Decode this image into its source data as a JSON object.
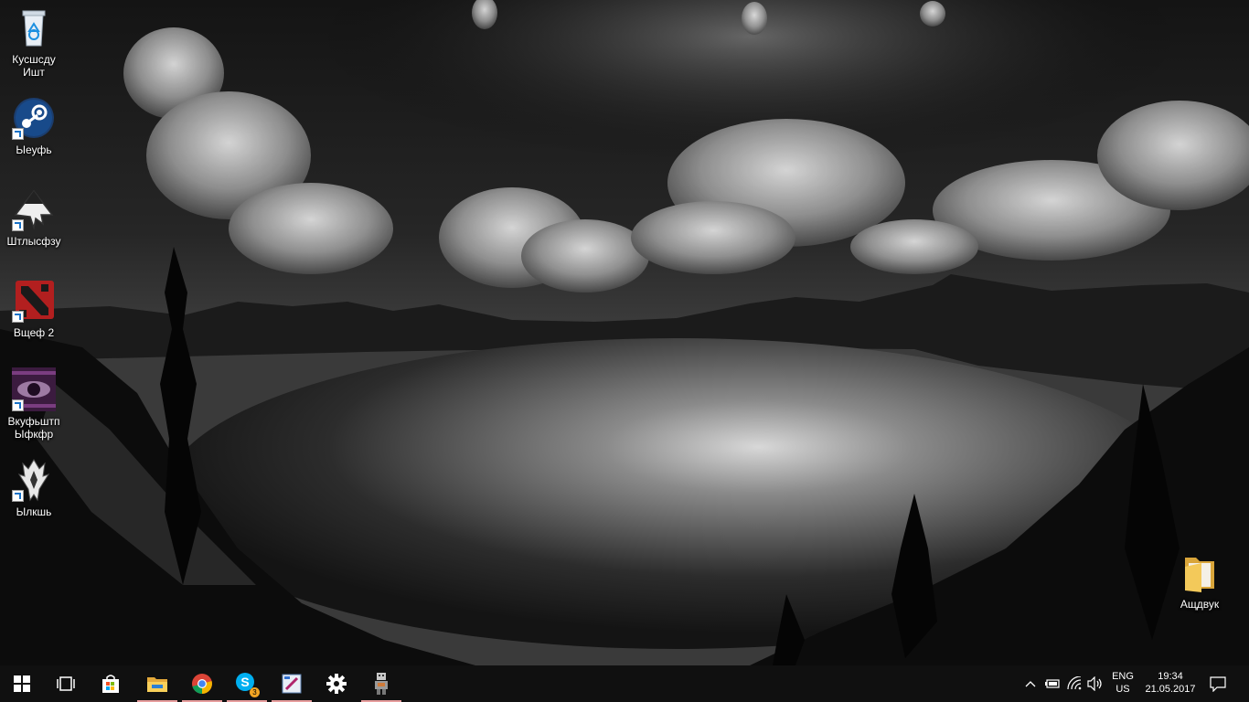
{
  "desktop": {
    "icons": [
      {
        "label": "Кусшсду Ишт",
        "icon": "recycle-bin-icon"
      },
      {
        "label": "Ыеуфь",
        "icon": "steam-icon"
      },
      {
        "label": "Штлысфзу",
        "icon": "inkscape-icon"
      },
      {
        "label": "Вщеф 2",
        "icon": "dota2-icon"
      },
      {
        "label": "Вкуфьштп Ыфкфр",
        "icon": "dreaming-sarah-icon"
      },
      {
        "label": "Ылкшь",
        "icon": "skyrim-icon"
      },
      {
        "label": "Ащдвук",
        "icon": "folder-icon"
      }
    ]
  },
  "taskbar": {
    "pinned": [
      {
        "name": "start-button",
        "icon": "windows-logo-icon"
      },
      {
        "name": "task-view-button",
        "icon": "task-view-icon"
      },
      {
        "name": "store-button",
        "icon": "store-icon"
      },
      {
        "name": "file-explorer-button",
        "icon": "folder-icon"
      },
      {
        "name": "chrome-button",
        "icon": "chrome-icon"
      },
      {
        "name": "skype-button",
        "icon": "skype-icon",
        "badge": "3"
      },
      {
        "name": "paint-button",
        "icon": "paint-icon"
      },
      {
        "name": "settings-button",
        "icon": "gear-icon"
      },
      {
        "name": "app-robot-button",
        "icon": "robot-icon"
      }
    ],
    "tray": {
      "language_top": "ENG",
      "language_bottom": "US",
      "time": "19:34",
      "date": "21.05.2017"
    }
  },
  "colors": {
    "taskbar_bg": "#101010",
    "running_indicator": "#e79e9e",
    "accent": "#1a73c8"
  }
}
